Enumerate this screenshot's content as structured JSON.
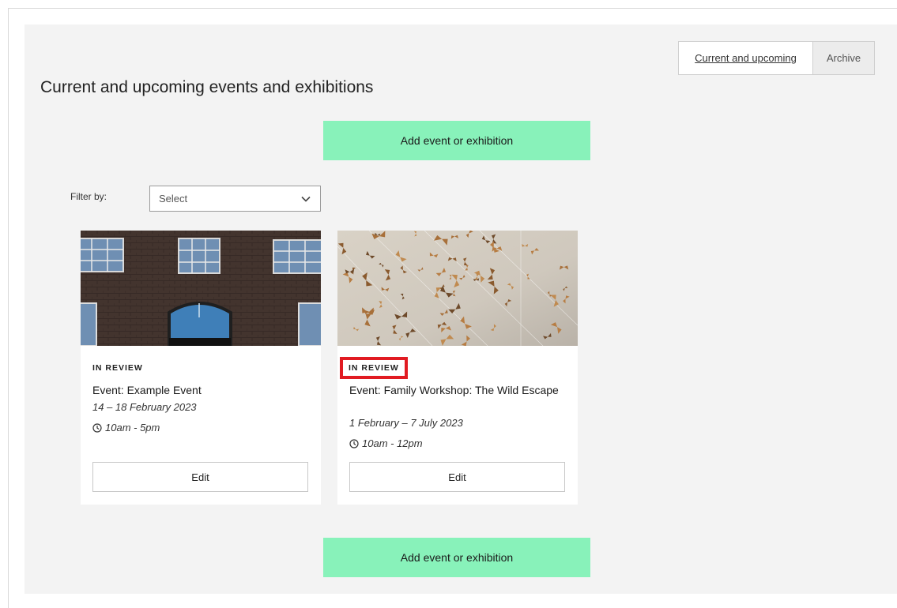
{
  "view_toggle": {
    "current_label": "Current and upcoming",
    "archive_label": "Archive"
  },
  "page": {
    "title": "Current and upcoming events and exhibitions"
  },
  "actions": {
    "add_label": "Add event or exhibition"
  },
  "filter": {
    "label": "Filter by:",
    "selected": "Select"
  },
  "cards": [
    {
      "image": "brick-building-photo",
      "status": "IN REVIEW",
      "title": "Event: Example Event",
      "dates": "14 – 18 February 2023",
      "time": "10am - 5pm",
      "edit_label": "Edit"
    },
    {
      "image": "moths-installation-photo",
      "status": "IN REVIEW",
      "title": "Event: Family Workshop: The Wild Escape",
      "dates": "1 February – 7 July 2023",
      "time": "10am - 12pm",
      "edit_label": "Edit"
    }
  ],
  "colors": {
    "accent_button": "#88f2ba",
    "highlight": "#e11b22",
    "panel_bg": "#f3f3f3"
  }
}
